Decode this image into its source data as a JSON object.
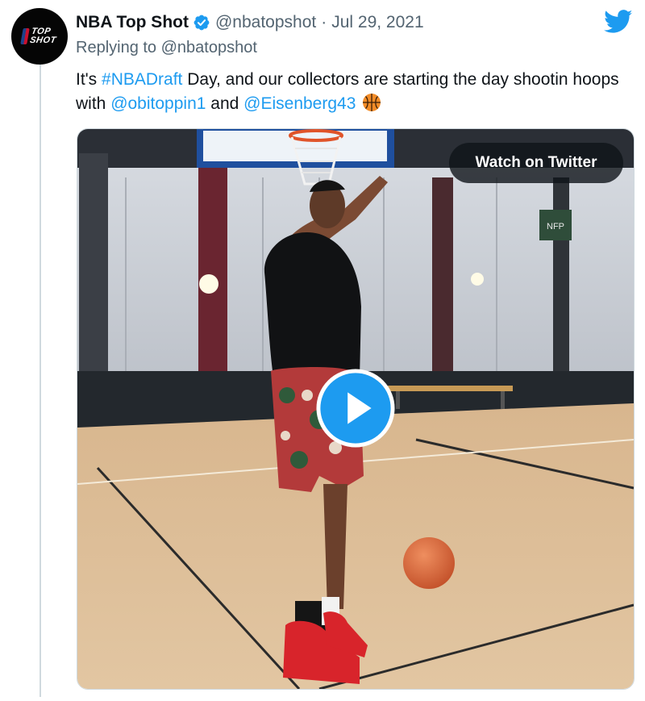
{
  "tweet": {
    "display_name": "NBA Top Shot",
    "handle": "@nbatopshot",
    "separator": "·",
    "date": "Jul 29, 2021",
    "replying_to": "Replying to @nbatopshot",
    "text_segments": [
      {
        "text": "It's ",
        "type": "plain"
      },
      {
        "text": "#NBADraft",
        "type": "link"
      },
      {
        "text": " Day, and our collectors are starting the day shootin hoops with ",
        "type": "plain"
      },
      {
        "text": "@obitoppin1",
        "type": "link"
      },
      {
        "text": " and ",
        "type": "plain"
      },
      {
        "text": "@Eisenberg43",
        "type": "link"
      }
    ]
  },
  "avatar": {
    "logo_line_1": "TOP",
    "logo_line_2": "SHOT"
  },
  "media": {
    "watch_label": "Watch on Twitter",
    "sign_text": "NFP"
  },
  "icons": {
    "verified": "verified-badge-icon",
    "twitter": "twitter-bird-icon",
    "emoji": "basketball-icon",
    "play": "play-icon"
  },
  "colors": {
    "link": "#1d9bf0",
    "verified": "#1d9bf0",
    "text": "#0f1419",
    "muted": "#536471"
  }
}
